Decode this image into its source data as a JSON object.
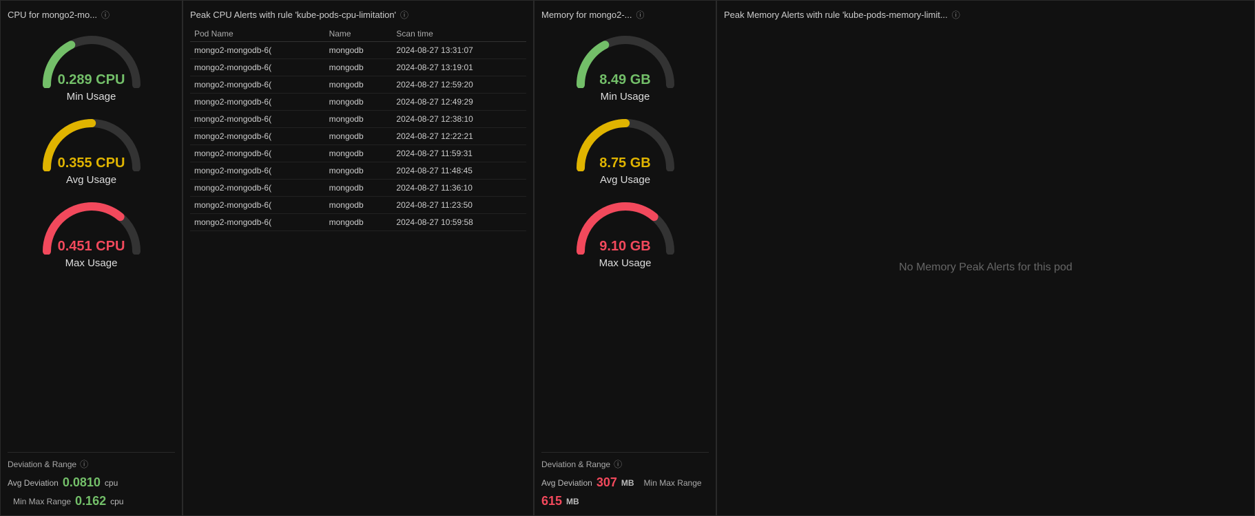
{
  "cpu_panel": {
    "title": "CPU for mongo2-mo...",
    "gauges": [
      {
        "value": "0.289 CPU",
        "label": "Min Usage",
        "color": "green",
        "arc_color": "#73bf69",
        "fill_pct": 0.35
      },
      {
        "value": "0.355 CPU",
        "label": "Avg Usage",
        "color": "yellow",
        "arc_color": "#e0b400",
        "fill_pct": 0.5
      },
      {
        "value": "0.451 CPU",
        "label": "Max Usage",
        "color": "red",
        "arc_color": "#f2495c",
        "fill_pct": 0.72
      }
    ],
    "deviation_title": "Deviation & Range",
    "avg_deviation_label": "Avg Deviation",
    "avg_deviation_value": "0.0810",
    "avg_deviation_unit": "cpu",
    "range_label": "Min Max Range",
    "range_value": "0.162",
    "range_unit": "cpu"
  },
  "cpu_alerts_panel": {
    "title": "Peak CPU Alerts with rule 'kube-pods-cpu-limitation'",
    "columns": [
      "Pod Name",
      "Name",
      "Scan time"
    ],
    "rows": [
      {
        "pod": "mongo2-mongodb-6(",
        "name": "mongodb",
        "time": "2024-08-27 13:31:07"
      },
      {
        "pod": "mongo2-mongodb-6(",
        "name": "mongodb",
        "time": "2024-08-27 13:19:01"
      },
      {
        "pod": "mongo2-mongodb-6(",
        "name": "mongodb",
        "time": "2024-08-27 12:59:20"
      },
      {
        "pod": "mongo2-mongodb-6(",
        "name": "mongodb",
        "time": "2024-08-27 12:49:29"
      },
      {
        "pod": "mongo2-mongodb-6(",
        "name": "mongodb",
        "time": "2024-08-27 12:38:10"
      },
      {
        "pod": "mongo2-mongodb-6(",
        "name": "mongodb",
        "time": "2024-08-27 12:22:21"
      },
      {
        "pod": "mongo2-mongodb-6(",
        "name": "mongodb",
        "time": "2024-08-27 11:59:31"
      },
      {
        "pod": "mongo2-mongodb-6(",
        "name": "mongodb",
        "time": "2024-08-27 11:48:45"
      },
      {
        "pod": "mongo2-mongodb-6(",
        "name": "mongodb",
        "time": "2024-08-27 11:36:10"
      },
      {
        "pod": "mongo2-mongodb-6(",
        "name": "mongodb",
        "time": "2024-08-27 11:23:50"
      },
      {
        "pod": "mongo2-mongodb-6(",
        "name": "mongodb",
        "time": "2024-08-27 10:59:58"
      }
    ]
  },
  "memory_panel": {
    "title": "Memory for mongo2-...",
    "gauges": [
      {
        "value": "8.49 GB",
        "label": "Min Usage",
        "color": "green",
        "arc_color": "#73bf69",
        "fill_pct": 0.35
      },
      {
        "value": "8.75 GB",
        "label": "Avg Usage",
        "color": "yellow",
        "arc_color": "#e0b400",
        "fill_pct": 0.5
      },
      {
        "value": "9.10 GB",
        "label": "Max Usage",
        "color": "red",
        "arc_color": "#f2495c",
        "fill_pct": 0.72
      }
    ],
    "deviation_title": "Deviation & Range",
    "avg_deviation_label": "Avg Deviation",
    "avg_deviation_value": "307",
    "avg_deviation_unit": "MB",
    "range_label": "Min Max Range",
    "range_value": "615",
    "range_unit": "MB"
  },
  "peak_memory_panel": {
    "title": "Peak Memory Alerts with rule 'kube-pods-memory-limit...",
    "no_alerts_text": "No Memory Peak Alerts for this pod"
  }
}
